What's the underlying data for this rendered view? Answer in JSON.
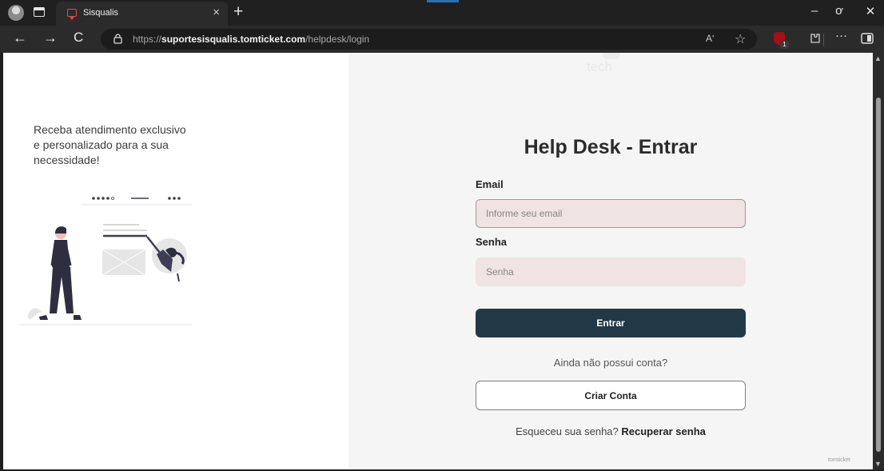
{
  "browser": {
    "tab_title": "Sisqualis",
    "tab_close": "×",
    "new_tab": "+",
    "url_prefix": "https://",
    "url_host": "suportesisqualis.tomticket.com",
    "url_path": "/helpdesk/login",
    "read_aloud": "Aʹ",
    "extension_badge": "1",
    "window": {
      "minimize": "–",
      "maximize": "ơ",
      "close": "✕"
    },
    "nav": {
      "back": "←",
      "forward": "→",
      "refresh": "C"
    },
    "menu": "···"
  },
  "left": {
    "tagline": "Receba atendimento exclusivo e personalizado para a sua necessidade!"
  },
  "brand": {
    "faint_logo": "tech",
    "footer_logo": "tomticket"
  },
  "form": {
    "title": "Help Desk - Entrar",
    "email_label": "Email",
    "email_placeholder": "Informe seu email",
    "password_label": "Senha",
    "password_placeholder": "Senha",
    "submit_label": "Entrar",
    "no_account_prompt": "Ainda não possui conta?",
    "create_account_label": "Criar Conta",
    "forgot_prompt": "Esqueceu sua senha?",
    "recover_label": "Recuperar senha"
  },
  "colors": {
    "primary_button": "#233846",
    "input_background": "#efe3e3",
    "right_panel_background": "#f5f5f5"
  }
}
